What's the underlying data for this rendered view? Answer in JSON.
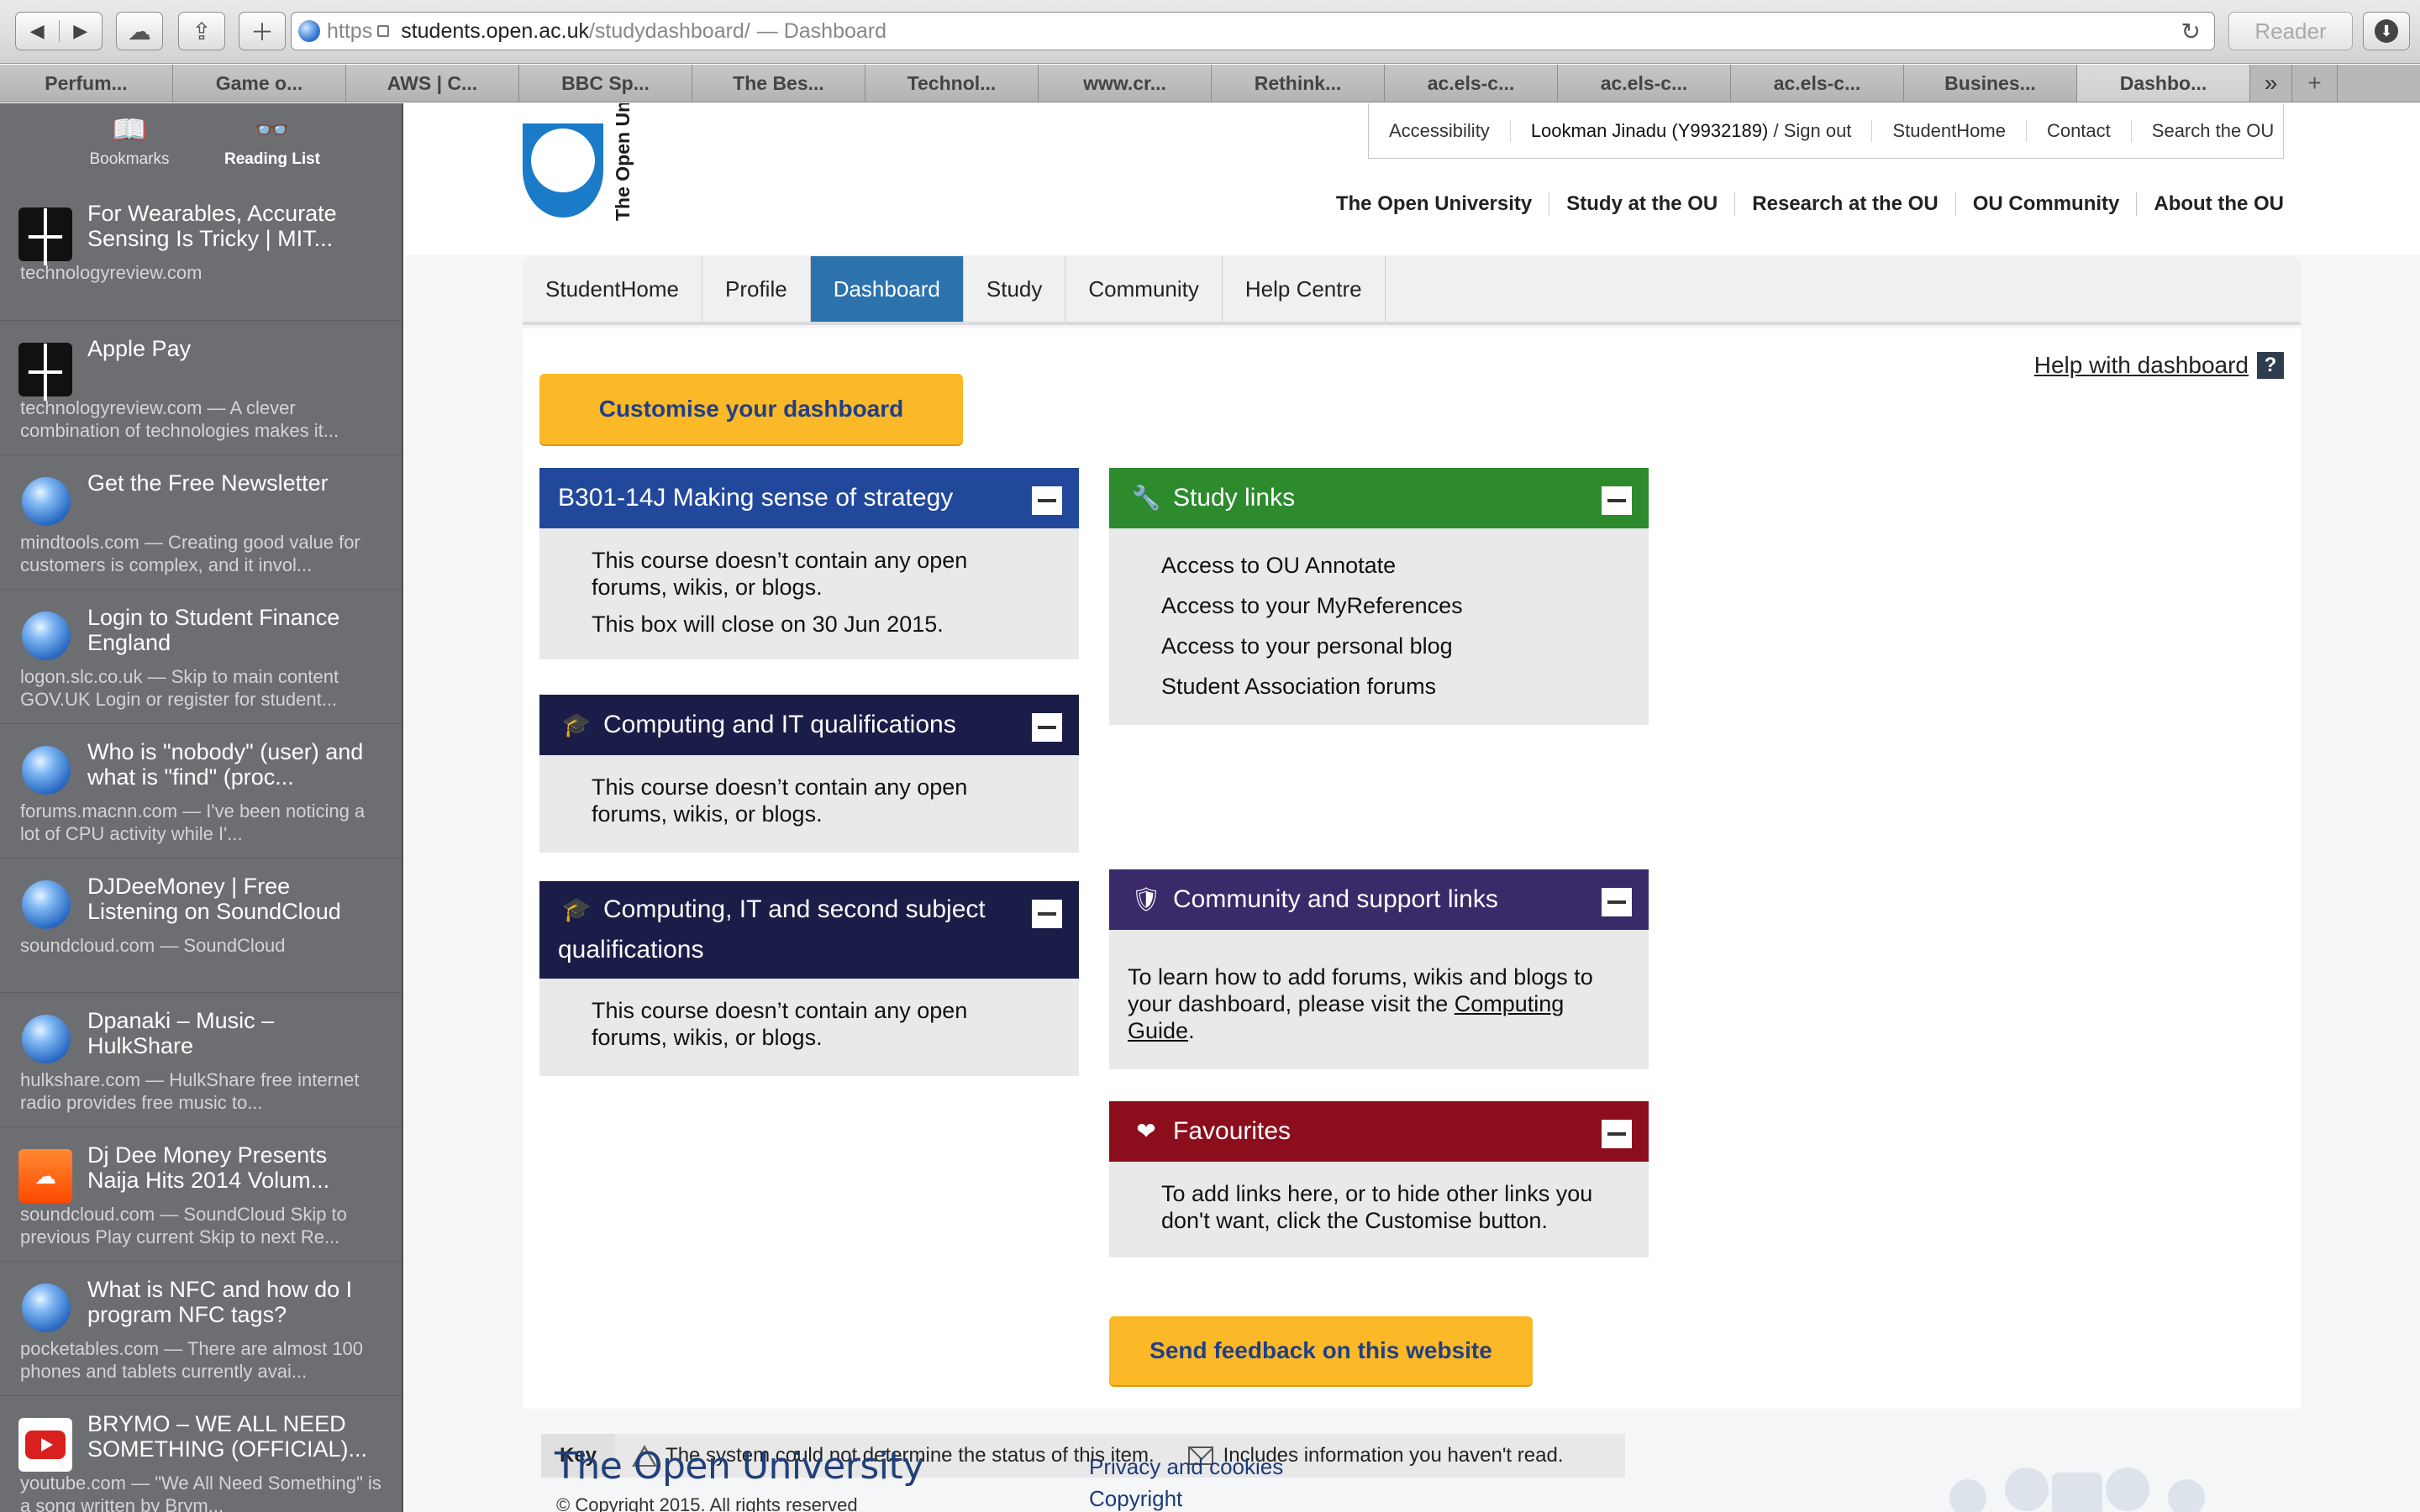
{
  "browser": {
    "url_scheme": "https",
    "url_host": "students.open.ac.uk",
    "url_path": "/studydashboard/",
    "page_title": "— Dashboard",
    "reader_label": "Reader",
    "tabs": [
      "Perfum...",
      "Game o...",
      "AWS | C...",
      "BBC Sp...",
      "The Bes...",
      "Technol...",
      "www.cr...",
      "Rethink...",
      "ac.els-c...",
      "ac.els-c...",
      "ac.els-c...",
      "Busines...",
      "Dashbo..."
    ]
  },
  "sidebar": {
    "bookmarks_label": "Bookmarks",
    "reading_list_label": "Reading List",
    "items": [
      {
        "icon": "technologyreview-icon",
        "title": "For Wearables, Accurate Sensing Is Tricky | MIT...",
        "desc": "technologyreview.com"
      },
      {
        "icon": "technologyreview-icon",
        "title": "Apple Pay",
        "desc": "technologyreview.com — A clever combination of technologies makes it..."
      },
      {
        "icon": "globe-icon",
        "title": "Get the Free Newsletter",
        "desc": "mindtools.com — Creating good value for customers is complex, and it invol..."
      },
      {
        "icon": "globe-icon",
        "title": "Login to Student Finance England",
        "desc": "logon.slc.co.uk — Skip to main content GOV.UK Login or register for student..."
      },
      {
        "icon": "globe-icon",
        "title": "Who is \"nobody\" (user) and what is \"find\" (proc...",
        "desc": "forums.macnn.com — I've been noticing a lot of CPU activity while I'..."
      },
      {
        "icon": "globe-icon",
        "title": "DJDeeMoney | Free Listening on SoundCloud",
        "desc": "soundcloud.com — SoundCloud"
      },
      {
        "icon": "globe-icon",
        "title": "Dpanaki – Music – HulkShare",
        "desc": "hulkshare.com — HulkShare free internet radio provides free music to..."
      },
      {
        "icon": "soundcloud-icon",
        "title": "Dj Dee Money Presents Naija Hits 2014 Volum...",
        "desc": "soundcloud.com — SoundCloud Skip to previous Play current Skip to next Re..."
      },
      {
        "icon": "globe-icon",
        "title": "What is NFC and how do I program NFC tags?",
        "desc": "pocketables.com — There are almost 100 phones and tablets currently avai..."
      },
      {
        "icon": "youtube-icon",
        "title": "BRYMO – WE ALL NEED SOMETHING (OFFICIAL)...",
        "desc": "youtube.com — \"We All Need Something\" is a song written by Brym..."
      }
    ]
  },
  "header": {
    "logo_text": "The Open University",
    "util_links": [
      "Accessibility",
      "Lookman Jinadu (Y9932189)",
      "/ Sign out",
      "StudentHome",
      "Contact",
      "Search the OU"
    ],
    "top_nav": [
      "The Open University",
      "Study at the OU",
      "Research at the OU",
      "OU Community",
      "About the OU"
    ],
    "main_tabs": [
      "StudentHome",
      "Profile",
      "Dashboard",
      "Study",
      "Community",
      "Help Centre"
    ],
    "active_tab": "Dashboard"
  },
  "content": {
    "help_link": "Help with dashboard",
    "help_icon": "?",
    "customise_button": "Customise your dashboard",
    "feedback_button": "Send feedback on this website",
    "left_boxes": [
      {
        "title": "B301-14J Making sense of strategy",
        "body": "This course doesn’t contain any open forums, wikis, or blogs.",
        "extra": "This box will close on 30 Jun 2015."
      },
      {
        "title": "Computing and IT qualifications",
        "body": "This course doesn’t contain any open forums, wikis, or blogs."
      },
      {
        "title": "Computing, IT and second subject qualifications",
        "body": "This course doesn’t contain any open forums, wikis, or blogs."
      }
    ],
    "study_links": {
      "title": "Study links",
      "items": [
        "Access to OU Annotate",
        "Access to your MyReferences",
        "Access to your personal blog",
        "Student Association forums"
      ]
    },
    "community": {
      "title": "Community and support links",
      "body_pre": "To learn how to add forums, wikis and blogs to your dashboard, please visit the",
      "link": "Computing Guide",
      "body_post": "."
    },
    "favourites": {
      "title": "Favourites",
      "body": "To add links here, or to hide other links you don't want, click the Customise button."
    },
    "key": {
      "label": "Key",
      "warning_text": "The system could not determine the status of this item.",
      "unread_text": "Includes information you haven't read."
    }
  },
  "footer": {
    "brand": "The Open University",
    "copyright": "© Copyright 2015. All rights reserved",
    "links": [
      "Privacy and cookies",
      "Copyright"
    ]
  },
  "colors": {
    "active_tab": "#2c73ad",
    "blue_header": "#22489b",
    "navy_header": "#1a1d47",
    "green_header": "#2d8a2d",
    "purple_header": "#3a2a6a",
    "red_header": "#8c0e1d",
    "yellow_button": "#fbb927"
  }
}
